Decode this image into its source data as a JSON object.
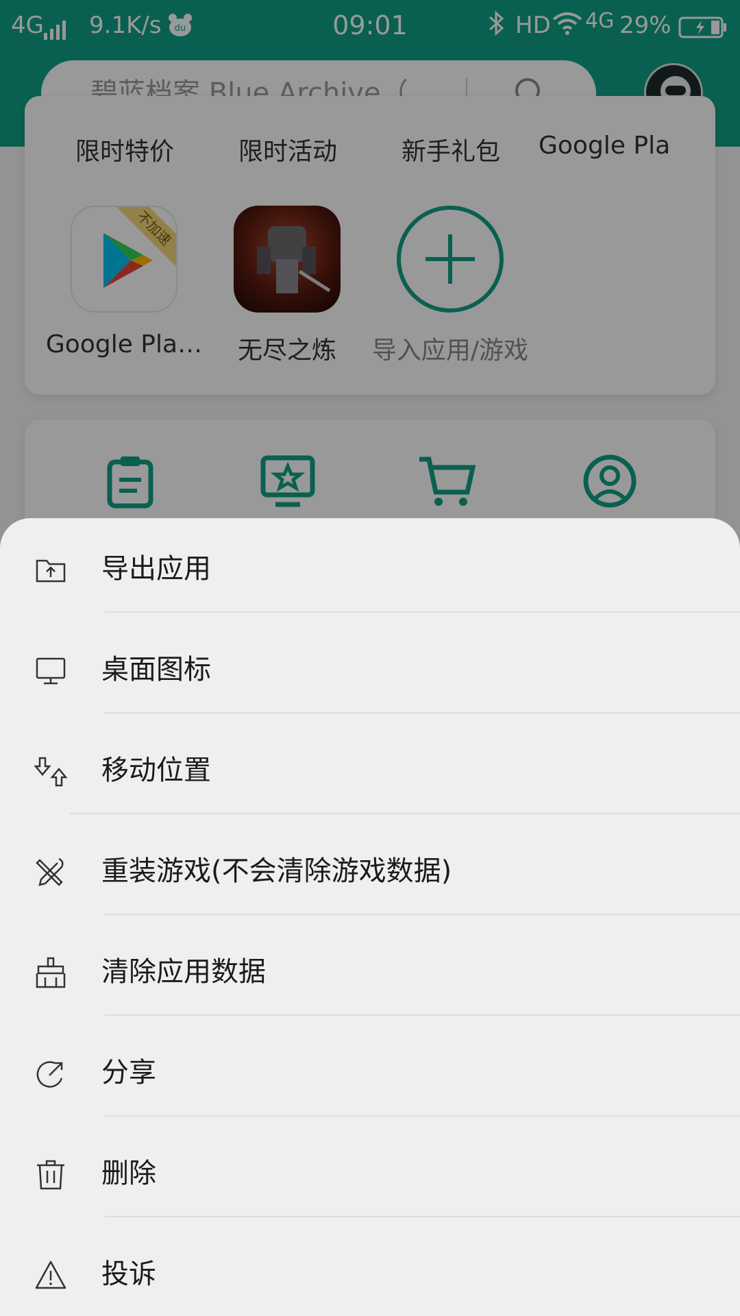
{
  "status_bar": {
    "network": "4G",
    "speed": "9.1K/s",
    "time": "09:01",
    "hd": "HD",
    "network2": "4G",
    "battery": "29%"
  },
  "search": {
    "placeholder": "碧蓝档案 Blue Archive（…"
  },
  "categories": [
    "限时特价",
    "限时活动",
    "新手礼包",
    "Google Pla"
  ],
  "apps": [
    {
      "name": "Google Pla…",
      "badge": "不加速"
    },
    {
      "name": "无尽之炼"
    },
    {
      "name": "导入应用/游戏"
    }
  ],
  "menu": [
    {
      "label": "导出应用",
      "icon": "export-folder-icon"
    },
    {
      "label": "桌面图标",
      "icon": "monitor-icon"
    },
    {
      "label": "移动位置",
      "icon": "move-arrows-icon"
    },
    {
      "label": "重装游戏(不会清除游戏数据)",
      "icon": "tools-icon"
    },
    {
      "label": "清除应用数据",
      "icon": "broom-icon"
    },
    {
      "label": "分享",
      "icon": "share-icon"
    },
    {
      "label": "删除",
      "icon": "trash-icon"
    },
    {
      "label": "投诉",
      "icon": "warning-icon"
    }
  ],
  "colors": {
    "accent": "#10a186",
    "sheet_background": "#efefef"
  }
}
